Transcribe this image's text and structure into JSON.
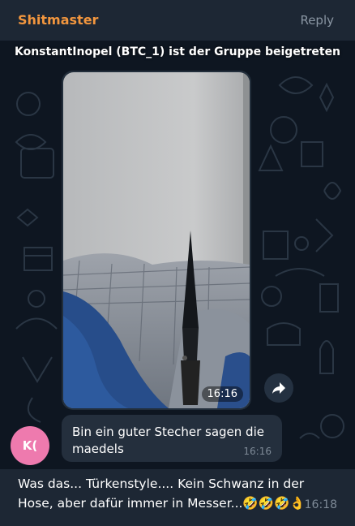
{
  "reply_header": {
    "sender": "Shitmaster",
    "reply_label": "Reply"
  },
  "service_message": "KonstantInopel (BTC_1) ist der Gruppe beigetreten",
  "photo_message": {
    "time": "16:16",
    "content": "photo of a dark knife blade held upright against a bed with blue and checkered sheets",
    "forward_icon": "share-arrow-icon"
  },
  "text_message": {
    "text": "Bin ein guter Stecher sagen die maedels",
    "time": "16:16"
  },
  "avatar": {
    "initials": "K(",
    "color": "#ee7aae"
  },
  "reply_preview": {
    "text": "Was das... Türkenstyle.... Kein Schwanz in der Hose, aber dafür immer in Messer...🤣🤣🤣👌",
    "time": "16:18"
  },
  "colors": {
    "background": "#0e1621",
    "bar": "#1d2734",
    "bubble": "#242f3d",
    "sender_name": "#f2963e",
    "muted": "#7e8a97"
  }
}
